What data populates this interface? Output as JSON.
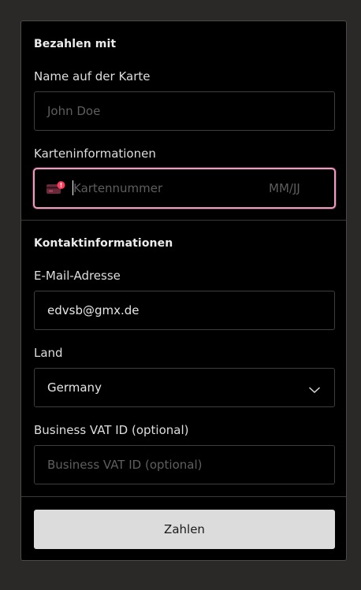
{
  "payment": {
    "section_title": "Bezahlen mit",
    "name_label": "Name auf der Karte",
    "name_placeholder": "John Doe",
    "card_label": "Karteninformationen",
    "card_number_placeholder": "Kartennummer",
    "expiry_placeholder": "MM/JJ",
    "card_icon": "card-error-icon",
    "card_error_color": "#f29ac0"
  },
  "contact": {
    "section_title": "Kontaktinformationen",
    "email_label": "E-Mail-Adresse",
    "email_value": "edvsb@gmx.de",
    "country_label": "Land",
    "country_value": "Germany",
    "dropdown_icon": "chevron-down-icon",
    "vat_label": "Business VAT ID (optional)",
    "vat_placeholder": "Business VAT ID (optional)"
  },
  "actions": {
    "pay_label": "Zahlen"
  }
}
